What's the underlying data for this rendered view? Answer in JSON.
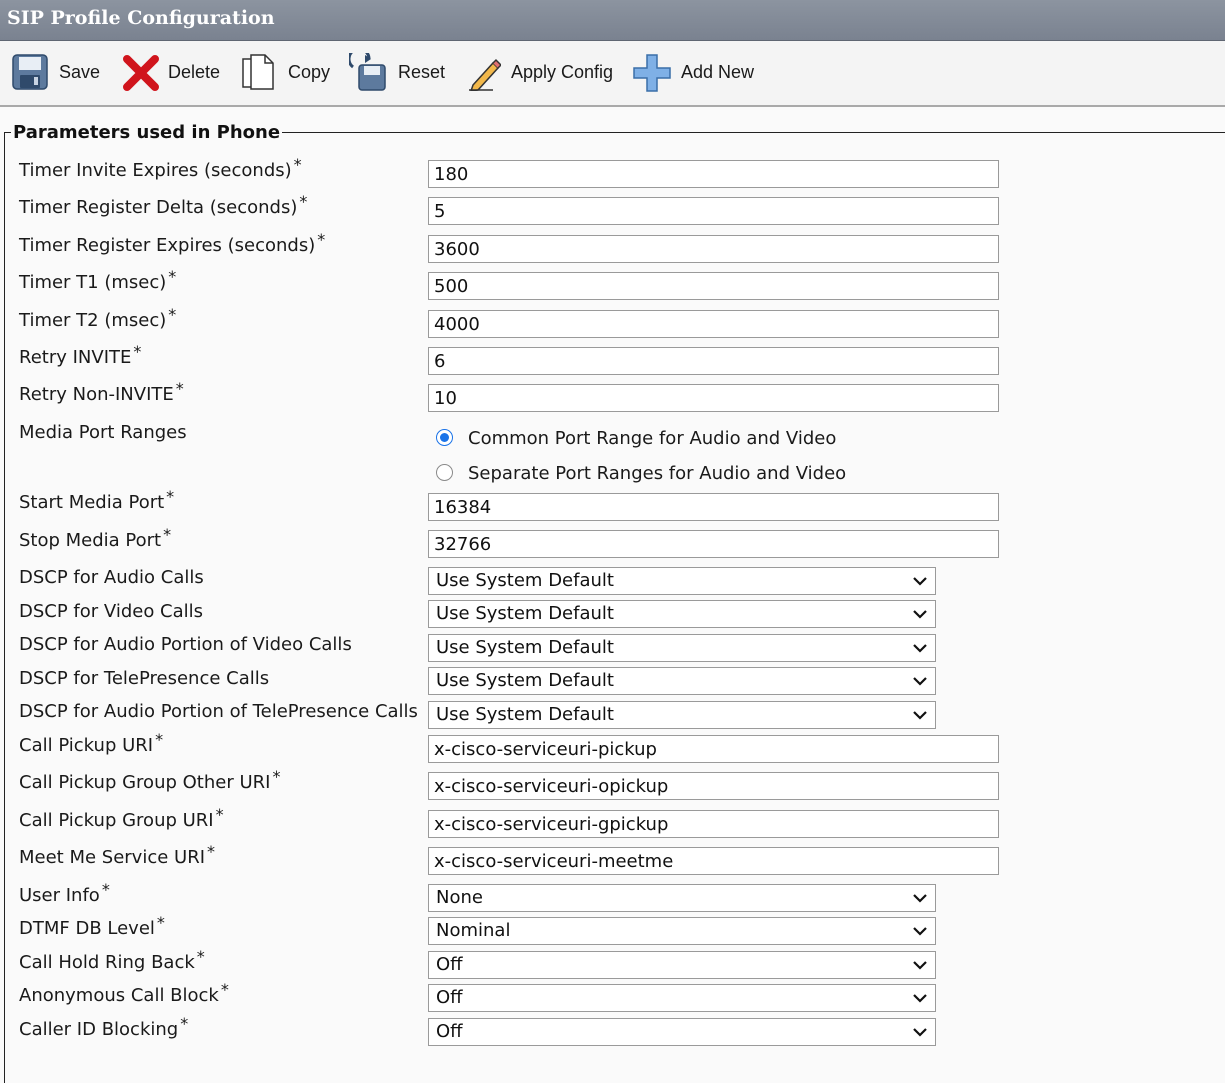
{
  "header": {
    "title": "SIP Profile Configuration"
  },
  "toolbar": {
    "save": "Save",
    "delete": "Delete",
    "copy": "Copy",
    "reset": "Reset",
    "apply_config": "Apply Config",
    "add_new": "Add New"
  },
  "section": {
    "legend": "Parameters used in Phone"
  },
  "fields": {
    "timer_invite_expires": {
      "label": "Timer Invite Expires (seconds)",
      "required": "*",
      "value": "180"
    },
    "timer_register_delta": {
      "label": "Timer Register Delta (seconds)",
      "required": "*",
      "value": "5"
    },
    "timer_register_expires": {
      "label": "Timer Register Expires (seconds)",
      "required": "*",
      "value": "3600"
    },
    "timer_t1": {
      "label": "Timer T1 (msec)",
      "required": "*",
      "value": "500"
    },
    "timer_t2": {
      "label": "Timer T2 (msec)",
      "required": "*",
      "value": "4000"
    },
    "retry_invite": {
      "label": "Retry INVITE",
      "required": "*",
      "value": "6"
    },
    "retry_non_invite": {
      "label": "Retry Non-INVITE",
      "required": "*",
      "value": "10"
    },
    "media_port_ranges": {
      "label": "Media Port Ranges",
      "option_common": "Common Port Range for Audio and Video",
      "option_separate": "Separate Port Ranges for Audio and Video",
      "selected": "common"
    },
    "start_media_port": {
      "label": "Start Media Port",
      "required": "*",
      "value": "16384"
    },
    "stop_media_port": {
      "label": "Stop Media Port",
      "required": "*",
      "value": "32766"
    },
    "dscp_audio": {
      "label": "DSCP for Audio Calls",
      "value": "Use System Default"
    },
    "dscp_video": {
      "label": "DSCP for Video Calls",
      "value": "Use System Default"
    },
    "dscp_audio_portion_video": {
      "label": "DSCP for Audio Portion of Video Calls",
      "value": "Use System Default"
    },
    "dscp_telepresence": {
      "label": "DSCP for TelePresence Calls",
      "value": "Use System Default"
    },
    "dscp_audio_portion_telepresence": {
      "label": "DSCP for Audio Portion of TelePresence Calls",
      "value": "Use System Default"
    },
    "call_pickup_uri": {
      "label": "Call Pickup URI",
      "required": "*",
      "value": "x-cisco-serviceuri-pickup"
    },
    "call_pickup_group_other_uri": {
      "label": "Call Pickup Group Other URI",
      "required": "*",
      "value": "x-cisco-serviceuri-opickup"
    },
    "call_pickup_group_uri": {
      "label": "Call Pickup Group URI",
      "required": "*",
      "value": "x-cisco-serviceuri-gpickup"
    },
    "meet_me_service_uri": {
      "label": "Meet Me Service URI",
      "required": "*",
      "value": "x-cisco-serviceuri-meetme"
    },
    "user_info": {
      "label": "User Info",
      "required": "*",
      "value": "None"
    },
    "dtmf_db_level": {
      "label": "DTMF DB Level",
      "required": "*",
      "value": "Nominal"
    },
    "call_hold_ring_back": {
      "label": "Call Hold Ring Back",
      "required": "*",
      "value": "Off"
    },
    "anonymous_call_block": {
      "label": "Anonymous Call Block",
      "required": "*",
      "value": "Off"
    },
    "caller_id_blocking": {
      "label": "Caller ID Blocking",
      "required": "*",
      "value": "Off"
    }
  },
  "colors": {
    "title_bar": "#828a97",
    "radio_accent": "#1a73e8",
    "delete_icon": "#d0141c",
    "add_icon": "#4a90d9"
  },
  "icons": [
    "save-icon",
    "delete-icon",
    "copy-icon",
    "reset-icon",
    "apply-config-icon",
    "add-new-icon",
    "chevron-down-icon"
  ]
}
